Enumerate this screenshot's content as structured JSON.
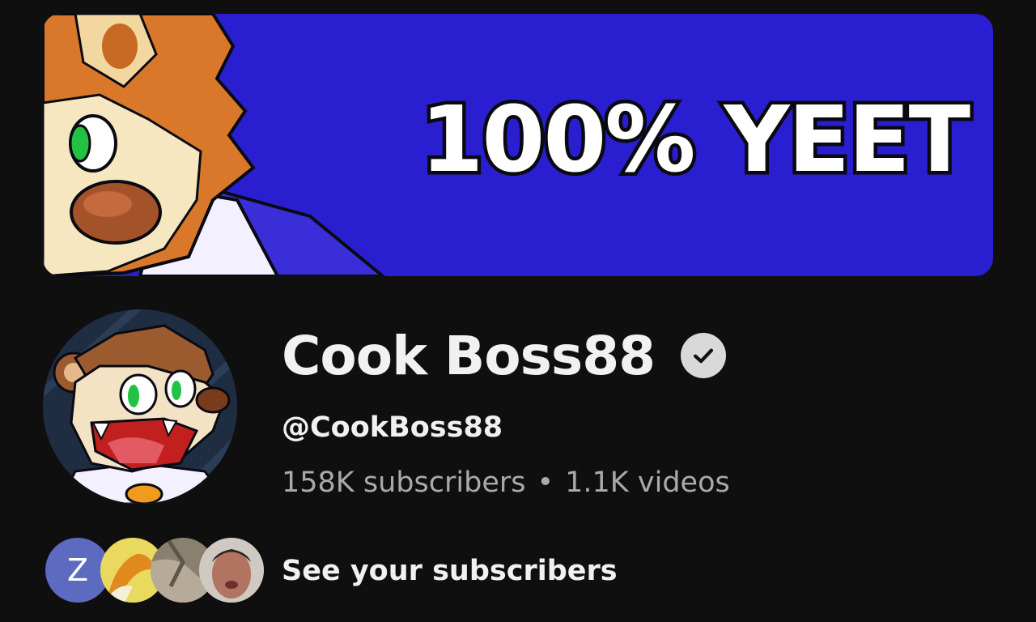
{
  "banner": {
    "text": "100% YEET",
    "background_color": "#2a1fd0"
  },
  "channel": {
    "name": "Cook Boss88",
    "verified_icon": "verified-check-icon",
    "handle": "@CookBoss88",
    "subscribers": "158K subscribers",
    "separator": "•",
    "videos": "1.1K videos"
  },
  "subscribers_preview": {
    "first_avatar_letter": "Z",
    "first_avatar_color": "#5c6bc0",
    "link_label": "See your subscribers"
  }
}
